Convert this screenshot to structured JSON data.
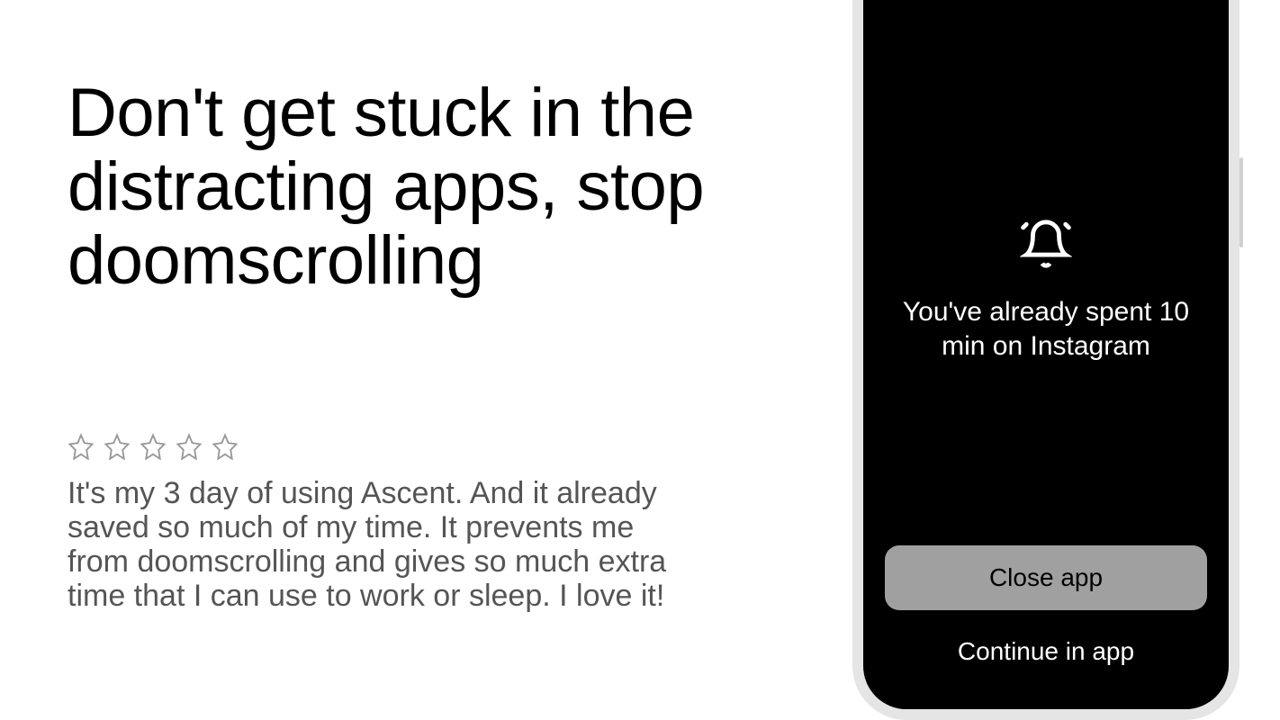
{
  "headline": "Don't get stuck in the distracting apps, stop doomscrolling",
  "review": {
    "stars": 5,
    "text": "It's my 3 day of using Ascent. And it already saved so much of my time. It prevents me from doomscrolling and gives so much extra time that I can use to work or sleep. I love it!"
  },
  "phone": {
    "alert_text": "You've already spent 10 min on Instagram",
    "primary_button": "Close app",
    "secondary_button": "Continue in app"
  }
}
